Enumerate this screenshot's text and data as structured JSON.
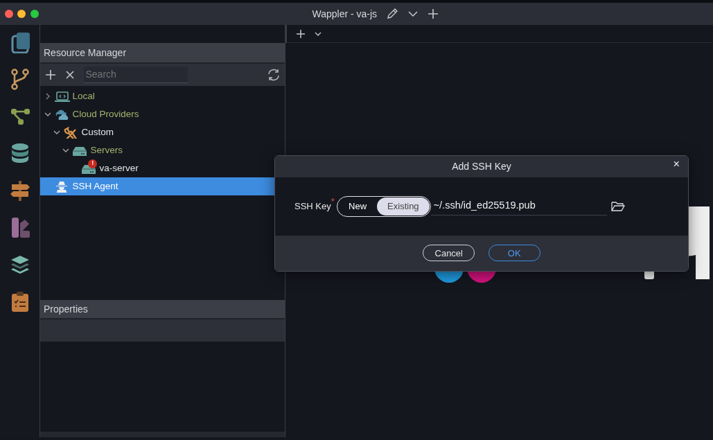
{
  "window": {
    "title": "Wappler - va-js"
  },
  "resource_manager": {
    "title": "Resource Manager",
    "search": {
      "placeholder": "Search"
    },
    "tree": [
      {
        "label": "Local",
        "kind": "laptop",
        "color": "#a4b56c",
        "expanded": false,
        "selected": false
      },
      {
        "label": "Cloud Providers",
        "kind": "cloud",
        "color": "#a4b56c",
        "expanded": true,
        "selected": false,
        "children": [
          {
            "label": "Custom",
            "kind": "tools",
            "color": "#e6e6e6",
            "expanded": true,
            "selected": false,
            "children": [
              {
                "label": "Servers",
                "kind": "server",
                "color": "#a4b56c",
                "expanded": true,
                "selected": false,
                "children": [
                  {
                    "label": "va-server",
                    "kind": "server",
                    "color": "#e6e6e6",
                    "badge": "!",
                    "selected": false
                  }
                ]
              }
            ]
          }
        ]
      },
      {
        "label": "SSH Agent",
        "kind": "agent",
        "color": "#ffffff",
        "selected": true
      }
    ]
  },
  "properties": {
    "title": "Properties"
  },
  "dialog": {
    "title": "Add SSH Key",
    "close": "×",
    "field_label": "SSH Key",
    "required_mark": "*",
    "options": [
      {
        "label": "New",
        "selected": false
      },
      {
        "label": "Existing",
        "selected": true
      }
    ],
    "value": "~/.ssh/id_ed25519.pub",
    "buttons": [
      {
        "label": "Cancel",
        "kind": "secondary"
      },
      {
        "label": "OK",
        "kind": "primary"
      }
    ]
  }
}
